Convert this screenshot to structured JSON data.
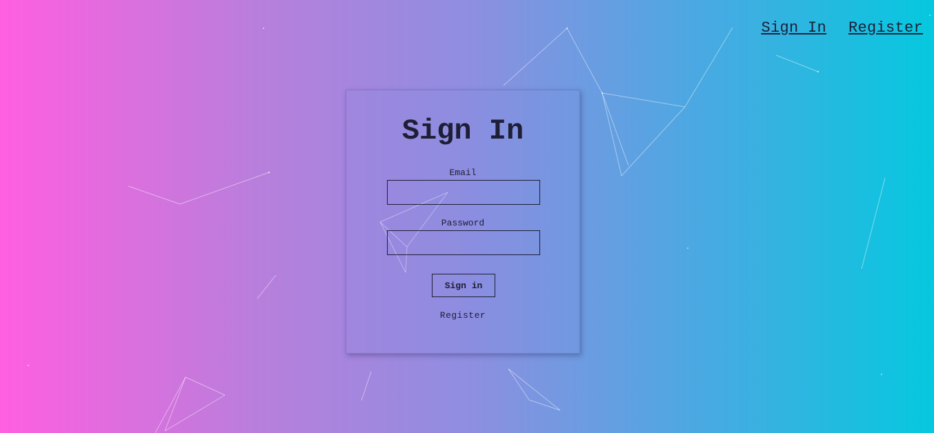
{
  "nav": {
    "sign_in": "Sign In",
    "register": "Register"
  },
  "form": {
    "title": "Sign In",
    "email_label": "Email",
    "email_value": "",
    "password_label": "Password",
    "password_value": "",
    "submit_label": "Sign in",
    "register_link": "Register"
  },
  "colors": {
    "gradient_start": "#ff5fe0",
    "gradient_mid": "#8f8ee0",
    "gradient_end": "#05c8df",
    "text": "#1e1e36"
  }
}
